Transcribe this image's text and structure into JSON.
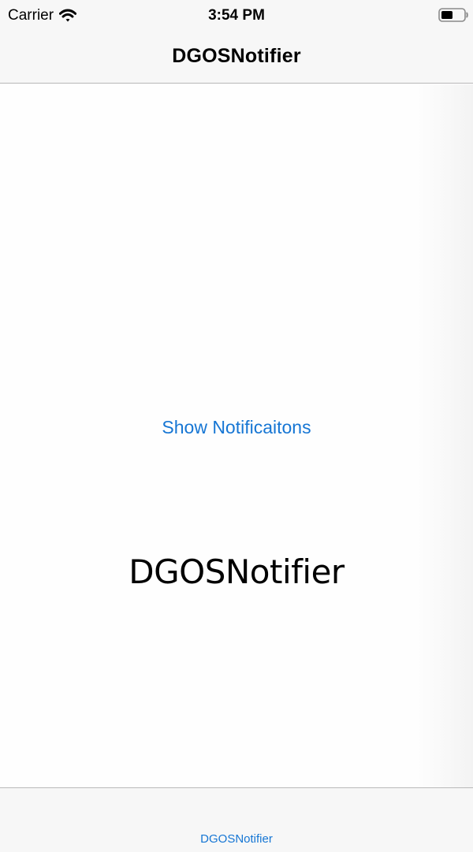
{
  "status_bar": {
    "carrier": "Carrier",
    "time": "3:54 PM",
    "wifi_icon": "wifi-icon",
    "battery_icon": "battery-icon"
  },
  "navigation": {
    "title": "DGOSNotifier"
  },
  "main": {
    "show_button_label": "Show Notificaitons",
    "center_label": "DGOSNotifier"
  },
  "tab_bar": {
    "items": [
      {
        "label": "DGOSNotifier"
      }
    ]
  },
  "colors": {
    "accent": "#1676d4",
    "bar_background": "#f7f7f7",
    "content_background": "#fdfcfd"
  }
}
